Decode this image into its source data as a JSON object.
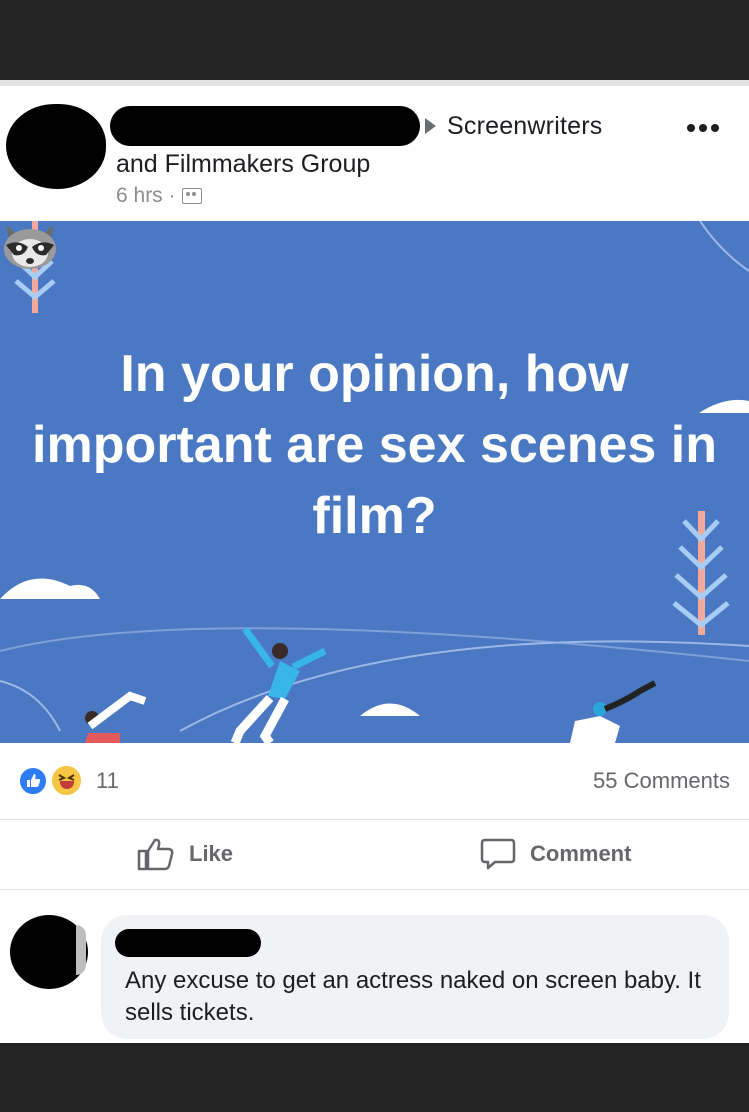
{
  "post": {
    "group_name_line1": "Screenwriters",
    "group_name_line2": "and Filmmakers Group",
    "time": "6 hrs ·",
    "more_icon": "more-horizontal-icon",
    "audience_icon": "group-members-icon"
  },
  "image": {
    "text": "In your opinion, how important are sex scenes in film?",
    "emoji": "raccoon",
    "background_color": "#4a78c2"
  },
  "reactions": {
    "count": "11",
    "comments": "55 Comments",
    "icons": [
      "like-reaction-icon",
      "haha-reaction-icon"
    ]
  },
  "actions": {
    "like_label": "Like",
    "comment_label": "Comment"
  },
  "comment": {
    "text": "Any excuse to get an actress naked on screen baby. It sells tickets."
  }
}
